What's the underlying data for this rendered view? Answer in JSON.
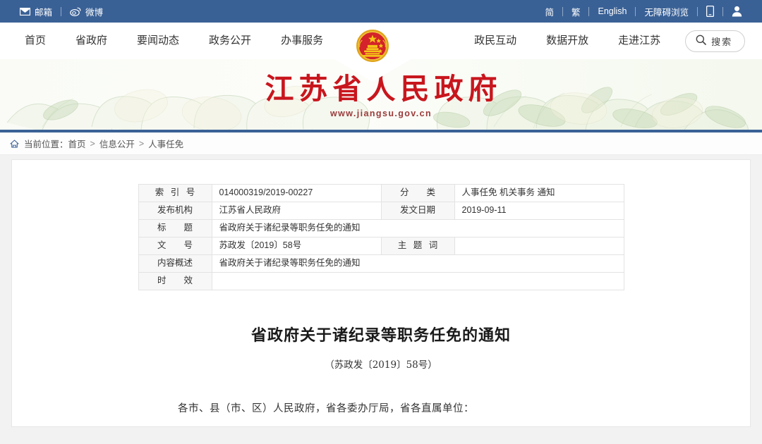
{
  "topbar": {
    "left_links": [
      {
        "label": "邮箱",
        "icon": "mail-icon"
      },
      {
        "label": "微博",
        "icon": "weibo-icon"
      }
    ],
    "right_links": [
      {
        "label": "简",
        "icon": null
      },
      {
        "label": "繁",
        "icon": null
      },
      {
        "label": "English",
        "icon": null
      },
      {
        "label": "无障碍浏览",
        "icon": null
      }
    ],
    "mobile_icon": "mobile-phone-icon",
    "user_icon": "user-account-icon"
  },
  "nav": {
    "left_items": [
      {
        "label": "首页"
      },
      {
        "label": "省政府"
      },
      {
        "label": "要闻动态"
      },
      {
        "label": "政务公开"
      },
      {
        "label": "办事服务"
      }
    ],
    "right_items": [
      {
        "label": "政民互动"
      },
      {
        "label": "数据开放"
      },
      {
        "label": "走进江苏"
      }
    ],
    "search_label": "搜索",
    "search_icon": "search-icon",
    "emblem_icon": "national-emblem-icon"
  },
  "banner": {
    "site_title": "江苏省人民政府",
    "site_url": "www.jiangsu.gov.cn",
    "title_color": "#c8161d",
    "accent_color": "#3a6196"
  },
  "breadcrumb": {
    "home_icon": "home-icon",
    "prefix": "当前位置：",
    "items": [
      "首页",
      "信息公开",
      "人事任免"
    ],
    "separator": ">"
  },
  "meta_table": {
    "rows": [
      {
        "left_label": "索 引 号",
        "left_value": "014000319/2019-00227",
        "right_label": "分　　类",
        "right_value": "人事任免 机关事务 通知"
      },
      {
        "left_label": "发布机构",
        "left_value": "江苏省人民政府",
        "right_label": "发文日期",
        "right_value": "2019-09-11"
      },
      {
        "left_label": "标　　题",
        "left_value": "省政府关于诸纪录等职务任免的通知",
        "right_label": null,
        "right_value": null
      },
      {
        "left_label": "文　　号",
        "left_value": "苏政发〔2019〕58号",
        "right_label": "主 题 词",
        "right_value": ""
      },
      {
        "left_label": "内容概述",
        "left_value": "省政府关于诸纪录等职务任免的通知",
        "right_label": null,
        "right_value": null
      },
      {
        "left_label": "时　　效",
        "left_value": "",
        "right_label": null,
        "right_value": null
      }
    ]
  },
  "document": {
    "title": "省政府关于诸纪录等职务任免的通知",
    "number": "（苏政发〔2019〕58号）",
    "salutation": "各市、县（市、区）人民政府，省各委办厅局，省各直属单位："
  }
}
